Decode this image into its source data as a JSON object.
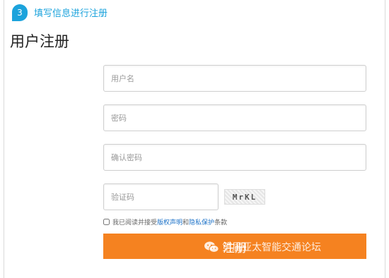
{
  "step": {
    "number": "3",
    "title": "填写信息进行注册"
  },
  "page_title": "用户注册",
  "form": {
    "username_placeholder": "用户名",
    "password_placeholder": "密码",
    "confirm_placeholder": "确认密码",
    "captcha_placeholder": "验证码",
    "captcha_text": "MrKL",
    "agree_prefix": "我已阅读并接受",
    "agree_link1": "版权声明",
    "agree_mid": "和",
    "agree_link2": "隐私保护",
    "agree_suffix": "条款",
    "register_label": "注册"
  },
  "watermark": {
    "text": "第届亚太智能交通论坛",
    "icon": "wechat-icon"
  },
  "colors": {
    "accent": "#1ca3dc",
    "button": "#f58220",
    "link": "#1c72c8"
  }
}
